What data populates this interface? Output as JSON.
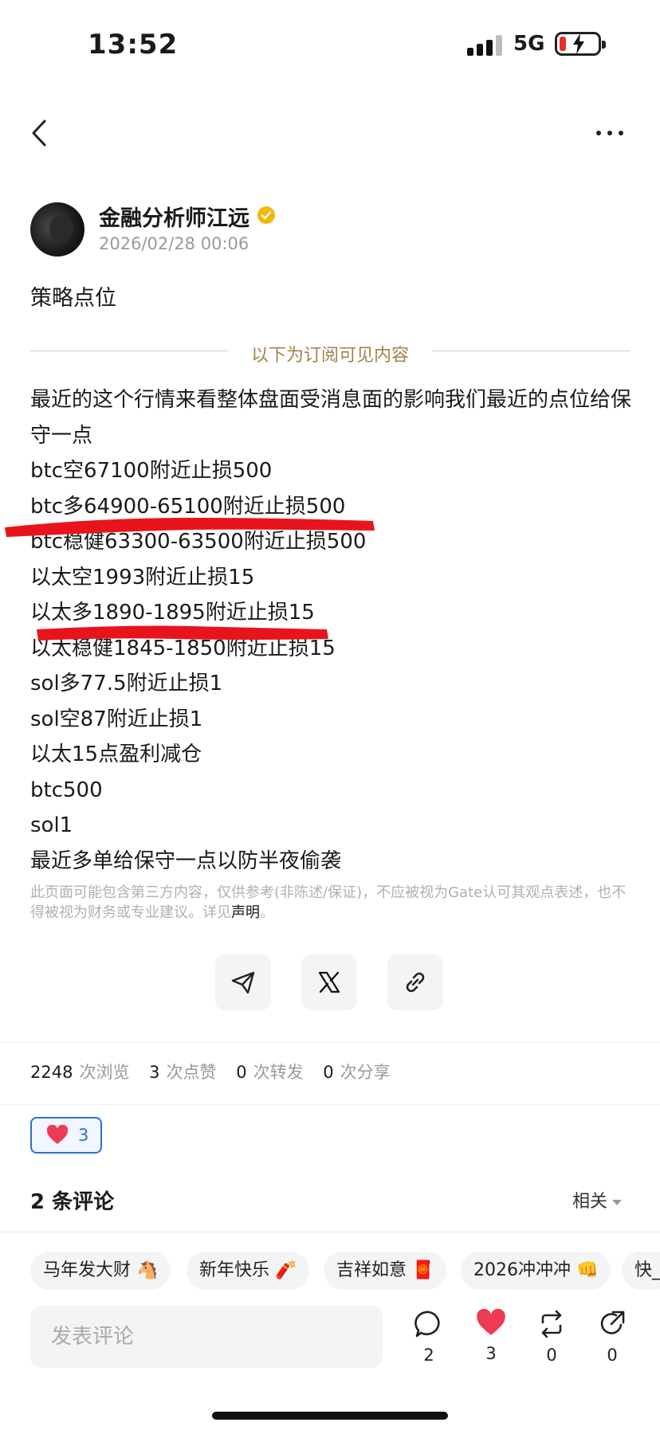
{
  "status_bar": {
    "time": "13:52",
    "network": "5G"
  },
  "author": {
    "name": "金融分析师江远",
    "time": "2026/02/28 00:06"
  },
  "post": {
    "title": "策略点位",
    "paywall_label": "以下为订阅可见内容",
    "lines": [
      "最近的这个行情来看整体盘面受消息面的影响我们最近的点位给保守一点",
      "btc空67100附近止损500",
      "btc多64900-65100附近止损500",
      "btc稳健63300-63500附近止损500",
      "以太空1993附近止损15",
      "以太多1890-1895附近止损15",
      "以太稳健1845-1850附近止损15",
      "sol多77.5附近止损1",
      "sol空87附近止损1",
      "以太15点盈利减仓",
      "btc500",
      "sol1",
      "最近多单给保守一点以防半夜偷袭"
    ],
    "disclaimer_text": "此页面可能包含第三方内容，仅供参考(非陈述/保证)，不应被视为Gate认可其观点表述，也不得被视为财务或专业建议。详见",
    "disclaimer_link": "声明",
    "disclaimer_end": "。"
  },
  "share_icons": [
    "send-icon",
    "x-icon",
    "link-icon"
  ],
  "stats": {
    "views": "2248",
    "views_label": "次浏览",
    "likes": "3",
    "likes_label": "次点赞",
    "reposts": "0",
    "reposts_label": "次转发",
    "shares": "0",
    "shares_label": "次分享"
  },
  "reaction": {
    "count": "3"
  },
  "comments": {
    "title": "2 条评论",
    "sort": "相关"
  },
  "quick_replies": [
    "马年发大财 🐴",
    "新年快乐 🧨",
    "吉祥如意 🧧",
    "2026冲冲冲 👊",
    "快_"
  ],
  "composer": {
    "placeholder": "发表评论"
  },
  "actions": {
    "comments": "2",
    "likes": "3",
    "reposts": "0",
    "shares": "0"
  },
  "colors": {
    "accent": "#2b6fd6",
    "like": "#ee3a54",
    "paywall": "#a2834b",
    "markup": "#e8141c"
  }
}
